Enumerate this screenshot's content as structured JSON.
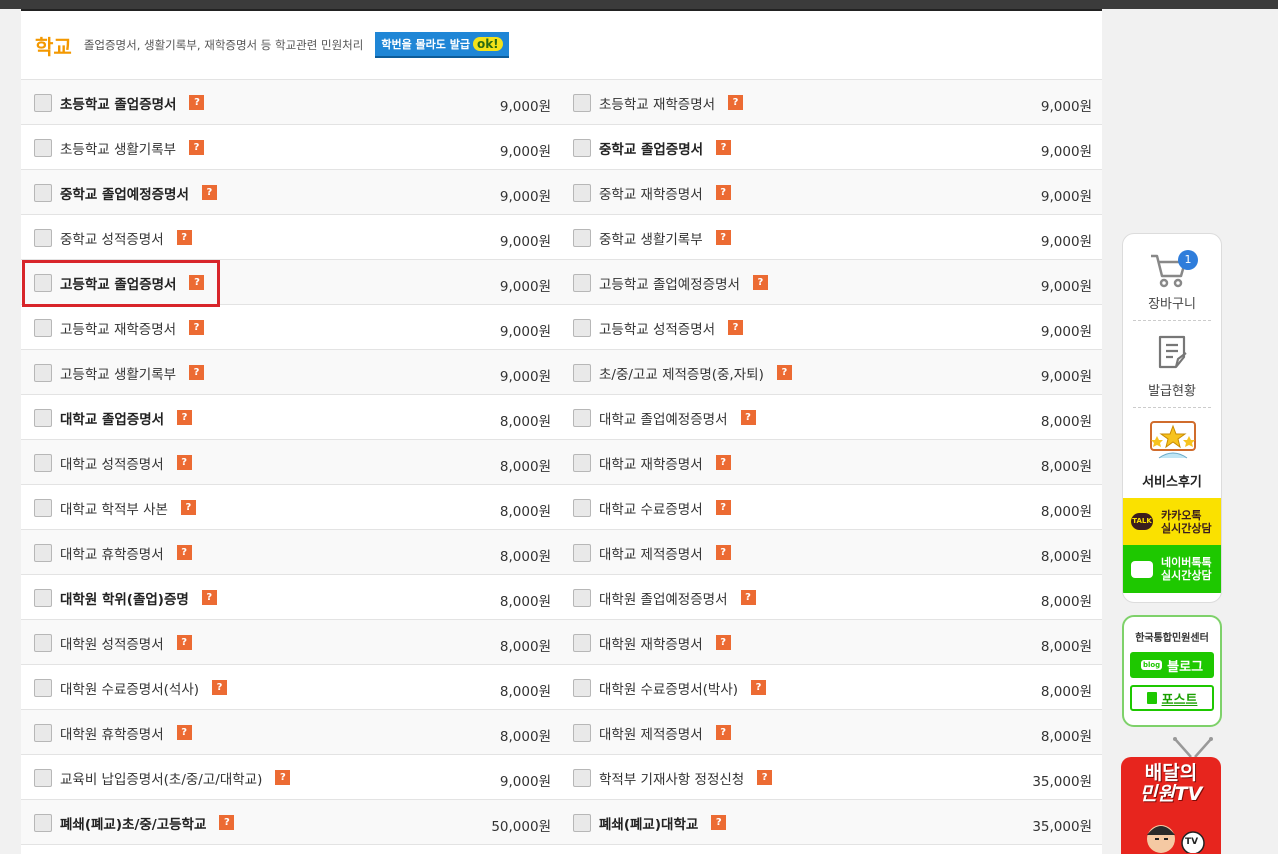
{
  "section": {
    "title": "학교",
    "description": "졸업증명서, 생활기록부, 재학증명서 등 학교관련 민원처리",
    "badge_text": "학번을 몰라도 발급",
    "badge_ok": "ok!"
  },
  "rows": [
    {
      "left": {
        "name": "초등학교 졸업증명서",
        "bold": true,
        "price": "9,000원"
      },
      "right": {
        "name": "초등학교 재학증명서",
        "bold": false,
        "price": "9,000원"
      }
    },
    {
      "left": {
        "name": "초등학교 생활기록부",
        "bold": false,
        "price": "9,000원"
      },
      "right": {
        "name": "중학교 졸업증명서",
        "bold": true,
        "price": "9,000원"
      }
    },
    {
      "left": {
        "name": "중학교 졸업예정증명서",
        "bold": true,
        "price": "9,000원"
      },
      "right": {
        "name": "중학교 재학증명서",
        "bold": false,
        "price": "9,000원"
      }
    },
    {
      "left": {
        "name": "중학교 성적증명서",
        "bold": false,
        "price": "9,000원"
      },
      "right": {
        "name": "중학교 생활기록부",
        "bold": false,
        "price": "9,000원"
      }
    },
    {
      "left": {
        "name": "고등학교 졸업증명서",
        "bold": true,
        "price": "9,000원"
      },
      "right": {
        "name": "고등학교 졸업예정증명서",
        "bold": false,
        "price": "9,000원"
      }
    },
    {
      "left": {
        "name": "고등학교 재학증명서",
        "bold": false,
        "price": "9,000원"
      },
      "right": {
        "name": "고등학교 성적증명서",
        "bold": false,
        "price": "9,000원"
      }
    },
    {
      "left": {
        "name": "고등학교 생활기록부",
        "bold": false,
        "price": "9,000원"
      },
      "right": {
        "name": "초/중/고교 제적증명(중,자퇴)",
        "bold": false,
        "price": "9,000원"
      }
    },
    {
      "left": {
        "name": "대학교 졸업증명서",
        "bold": true,
        "price": "8,000원"
      },
      "right": {
        "name": "대학교 졸업예정증명서",
        "bold": false,
        "price": "8,000원"
      }
    },
    {
      "left": {
        "name": "대학교 성적증명서",
        "bold": false,
        "price": "8,000원"
      },
      "right": {
        "name": "대학교 재학증명서",
        "bold": false,
        "price": "8,000원"
      }
    },
    {
      "left": {
        "name": "대학교 학적부 사본",
        "bold": false,
        "price": "8,000원"
      },
      "right": {
        "name": "대학교 수료증명서",
        "bold": false,
        "price": "8,000원"
      }
    },
    {
      "left": {
        "name": "대학교 휴학증명서",
        "bold": false,
        "price": "8,000원"
      },
      "right": {
        "name": "대학교 제적증명서",
        "bold": false,
        "price": "8,000원"
      }
    },
    {
      "left": {
        "name": "대학원 학위(졸업)증명",
        "bold": true,
        "price": "8,000원"
      },
      "right": {
        "name": "대학원 졸업예정증명서",
        "bold": false,
        "price": "8,000원"
      }
    },
    {
      "left": {
        "name": "대학원 성적증명서",
        "bold": false,
        "price": "8,000원"
      },
      "right": {
        "name": "대학원 재학증명서",
        "bold": false,
        "price": "8,000원"
      }
    },
    {
      "left": {
        "name": "대학원 수료증명서(석사)",
        "bold": false,
        "price": "8,000원"
      },
      "right": {
        "name": "대학원 수료증명서(박사)",
        "bold": false,
        "price": "8,000원"
      }
    },
    {
      "left": {
        "name": "대학원 휴학증명서",
        "bold": false,
        "price": "8,000원"
      },
      "right": {
        "name": "대학원 제적증명서",
        "bold": false,
        "price": "8,000원"
      }
    },
    {
      "left": {
        "name": "교육비 납입증명서(초/중/고/대학교)",
        "bold": false,
        "price": "9,000원"
      },
      "right": {
        "name": "학적부 기재사항 정정신청",
        "bold": false,
        "price": "35,000원"
      }
    },
    {
      "left": {
        "name": "폐쇄(폐교)초/중/고등학교",
        "bold": true,
        "price": "50,000원"
      },
      "right": {
        "name": "폐쇄(폐교)대학교",
        "bold": true,
        "price": "35,000원"
      }
    }
  ],
  "help_glyph": "?",
  "sidebar": {
    "cart_label": "장바구니",
    "cart_count": "1",
    "status_label": "발급현황",
    "review_label": "서비스후기",
    "kakao_icon": "TALK",
    "kakao_line1": "카카오톡",
    "kakao_line2": "실시간상담",
    "naver_line1": "네이버톡톡",
    "naver_line2": "실시간상담"
  },
  "blog_box": {
    "org": "한국통합민원센터",
    "blog_icon": "blog",
    "blog_label": "블로그",
    "post_label": "포스트"
  },
  "tv_banner": {
    "line1": "배달의",
    "line2": "민원TV",
    "badge": "TV"
  },
  "highlight_row": 4,
  "colors": {
    "accent": "#f39800",
    "help": "#ec6b33",
    "highlight": "#d8252a",
    "kakao": "#fae100",
    "naver": "#1ec800",
    "tv": "#e7251e"
  },
  "icons": [
    "cart-icon",
    "document-list-icon",
    "review-star-icon",
    "kakao-talk-icon",
    "naver-talk-icon",
    "blog-icon",
    "post-icon",
    "question-icon"
  ]
}
